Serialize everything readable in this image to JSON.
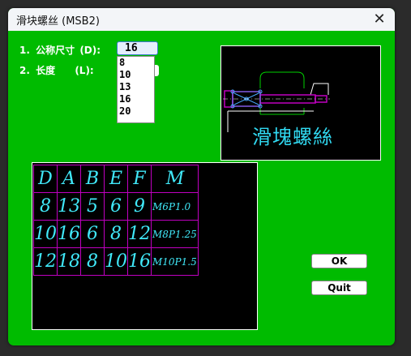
{
  "window": {
    "title": "滑块螺丝 (MSB2)",
    "close_glyph": "✕"
  },
  "labels": {
    "row1": {
      "num": "1.",
      "name": "公称尺寸",
      "key": "(D):"
    },
    "row2": {
      "num": "2.",
      "name": "长度",
      "key": "(L):"
    }
  },
  "combo_d": {
    "value": "16",
    "options": [
      "8",
      "10",
      "13",
      "16",
      "20"
    ]
  },
  "preview": {
    "caption": "滑塊螺絲"
  },
  "table": {
    "headers": [
      "D",
      "A",
      "B",
      "E",
      "F",
      "M"
    ],
    "rows": [
      [
        "8",
        "13",
        "5",
        "6",
        "9",
        "M6P1.0"
      ],
      [
        "10",
        "16",
        "6",
        "8",
        "12",
        "M8P1.25"
      ],
      [
        "12",
        "18",
        "8",
        "10",
        "16",
        "M10P1.5"
      ]
    ]
  },
  "buttons": {
    "ok": "OK",
    "quit": "Quit"
  },
  "colors": {
    "background": "#00bb00",
    "cad_cyan": "#40e8f8",
    "cad_magenta": "#c000c0",
    "cad_green": "#00d000"
  }
}
